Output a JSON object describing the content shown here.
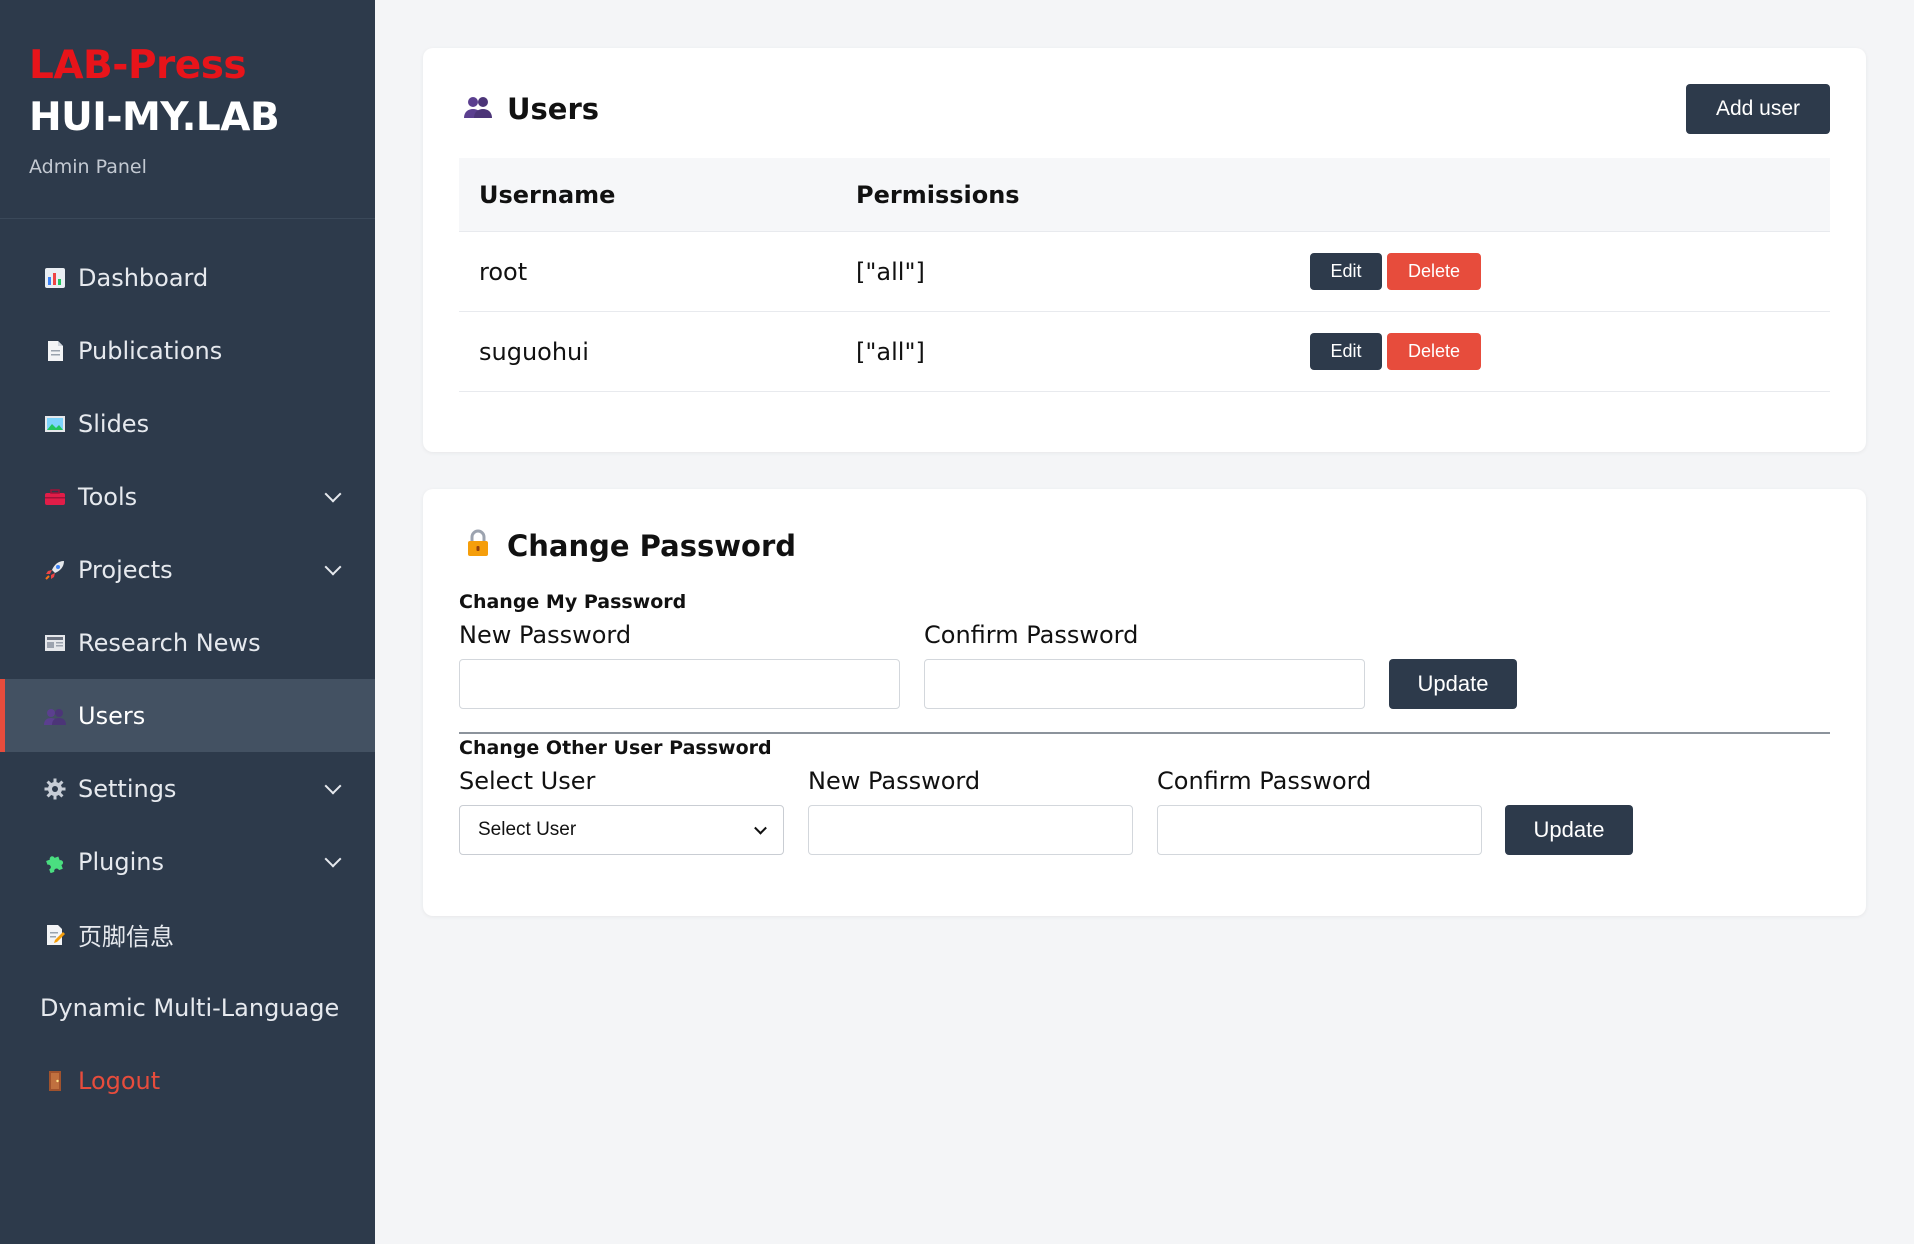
{
  "brand": {
    "top": "LAB-Press",
    "name": "HUI-MY.LAB",
    "subtitle": "Admin Panel"
  },
  "nav": {
    "items": [
      {
        "label": "Dashboard",
        "icon": "bar-chart-icon"
      },
      {
        "label": "Publications",
        "icon": "document-icon"
      },
      {
        "label": "Slides",
        "icon": "picture-icon"
      },
      {
        "label": "Tools",
        "icon": "toolbox-icon"
      },
      {
        "label": "Projects",
        "icon": "rocket-icon"
      },
      {
        "label": "Research News",
        "icon": "newspaper-icon"
      },
      {
        "label": "Users",
        "icon": "users-icon"
      },
      {
        "label": "Settings",
        "icon": "gear-icon"
      },
      {
        "label": "Plugins",
        "icon": "puzzle-icon"
      },
      {
        "label": "页脚信息",
        "icon": "memo-icon"
      },
      {
        "label": "Dynamic Multi-Language"
      },
      {
        "label": "Logout",
        "icon": "door-icon"
      }
    ],
    "active": "Users",
    "colors": {
      "sidebar_bg": "#2d3a4b",
      "active_bg": "#435162",
      "accent": "#e74c3c"
    }
  },
  "users": {
    "title": "Users",
    "add_label": "Add user",
    "columns": [
      "Username",
      "Permissions"
    ],
    "rows": [
      {
        "username": "root",
        "permissions": "[\"all\"]"
      },
      {
        "username": "suguohui",
        "permissions": "[\"all\"]"
      }
    ],
    "edit_label": "Edit",
    "delete_label": "Delete"
  },
  "password": {
    "title": "Change Password",
    "mine": {
      "section_label": "Change My Password",
      "new_label": "New Password",
      "confirm_label": "Confirm Password",
      "new_value": "",
      "confirm_value": "",
      "update_label": "Update"
    },
    "other": {
      "section_label": "Change Other User Password",
      "select_label": "Select User",
      "select_value": "Select User",
      "new_label": "New Password",
      "confirm_label": "Confirm Password",
      "new_value": "",
      "confirm_value": "",
      "update_label": "Update"
    }
  }
}
